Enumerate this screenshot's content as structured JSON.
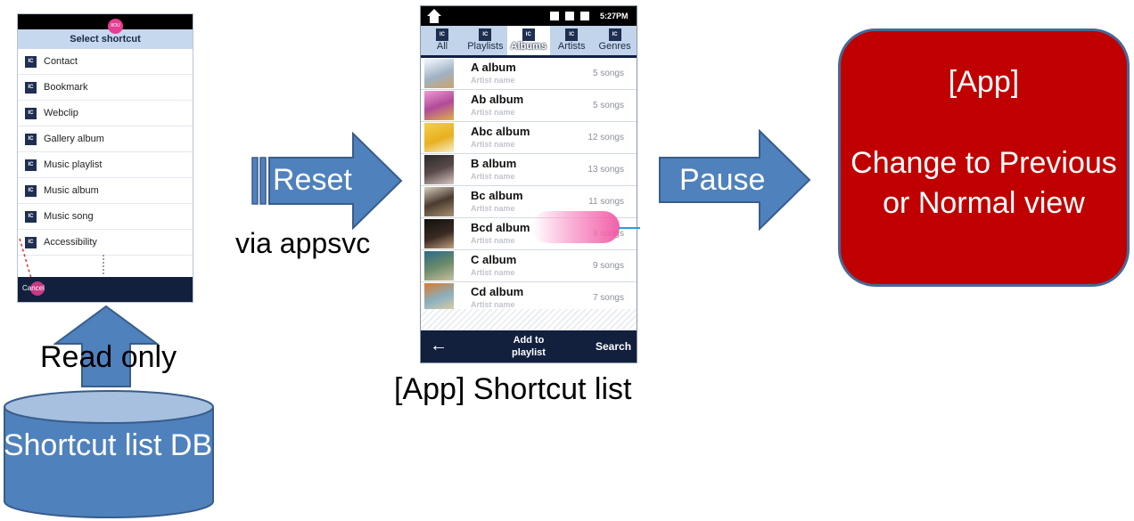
{
  "select_shortcut": {
    "title": "Select shortcut",
    "icon_text": "IC",
    "items": [
      "Contact",
      "Bookmark",
      "Webclip",
      "Gallery album",
      "Music playlist",
      "Music album",
      "Music song",
      "Accessibility"
    ],
    "badge": "8OU",
    "cancel_label": "Cancel"
  },
  "read_only_label": "Read only",
  "db_label": "Shortcut list DB",
  "reset_label": "Reset",
  "via_label": "via appsvc",
  "music_app": {
    "time": "5:27PM",
    "tab_icon_text": "IC",
    "tabs": [
      "All",
      "Playlists",
      "Albums",
      "Artists",
      "Genres"
    ],
    "selected_tab": "Albums",
    "albums": [
      {
        "title": "A album",
        "artist": "Artist name",
        "songs": "5 songs"
      },
      {
        "title": "Ab album",
        "artist": "Artist name",
        "songs": "5 songs"
      },
      {
        "title": "Abc album",
        "artist": "Artist name",
        "songs": "12 songs"
      },
      {
        "title": "B album",
        "artist": "Artist name",
        "songs": "13 songs"
      },
      {
        "title": "Bc album",
        "artist": "Artist name",
        "songs": "11 songs"
      },
      {
        "title": "Bcd album",
        "artist": "Artist name",
        "songs": "8 songs"
      },
      {
        "title": "C album",
        "artist": "Artist name",
        "songs": "9 songs"
      },
      {
        "title": "Cd album",
        "artist": "Artist name",
        "songs": "7 songs"
      }
    ],
    "back_icon": "back-arrow-icon",
    "add_to_playlist": "Add to playlist",
    "search": "Search"
  },
  "app_shortcut_caption": "[App] Shortcut list",
  "pause_label": "Pause",
  "app_box": {
    "title": "[App]",
    "body": "Change to Previous or Normal view",
    "fill_color": "#c00000"
  },
  "colors": {
    "arrow_fill": "#4f81bd",
    "arrow_border": "#385d8a",
    "dark_bar": "#12203e",
    "accent_pink": "#e83d92"
  }
}
